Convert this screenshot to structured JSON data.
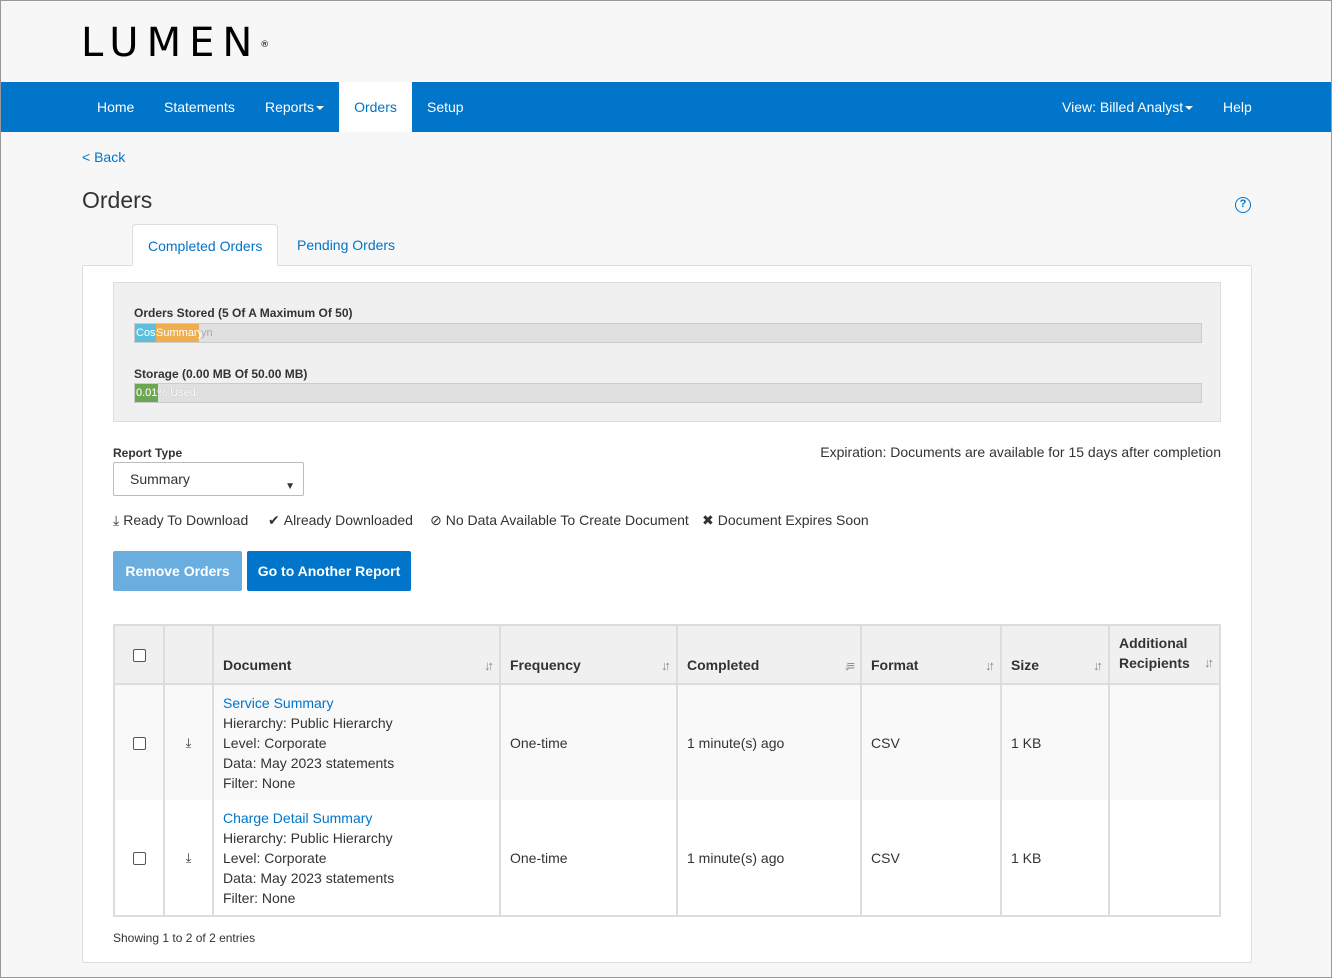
{
  "brand": {
    "logo_text": "LUMEN",
    "trademark": "®"
  },
  "nav": {
    "home": "Home",
    "statements": "Statements",
    "reports": "Reports",
    "orders": "Orders",
    "setup": "Setup",
    "view": "View: Billed Analyst",
    "help": "Help"
  },
  "back_label": "< Back",
  "page_title": "Orders",
  "help_icon_glyph": "?",
  "tabs": {
    "completed": "Completed Orders",
    "pending": "Pending Orders"
  },
  "usage": {
    "orders_label": "Orders Stored (5 Of A Maximum Of 50)",
    "orders_segments": [
      {
        "label": "Cos",
        "fraction": 0.02,
        "color": "#5bc0de"
      },
      {
        "label": "Summary",
        "fraction": 0.04,
        "color": "#f0ad4e"
      }
    ],
    "orders_overflow_text": "yn",
    "storage_label": "Storage (0.00 MB Of 50.00 MB)",
    "storage_fill_text": "0.01% Used",
    "storage_fraction": 0.022,
    "storage_color": "#6aa84f"
  },
  "report_type": {
    "label": "Report Type",
    "selected": "Summary"
  },
  "expiration": "Expiration: Documents are available for 15 days after completion",
  "legend": {
    "ready": "Ready To Download",
    "downloaded": "Already Downloaded",
    "no_data": "No Data Available To Create Document",
    "expires": "Document Expires Soon"
  },
  "buttons": {
    "remove": "Remove Orders",
    "goto": "Go to Another Report"
  },
  "table": {
    "headers": {
      "document": "Document",
      "frequency": "Frequency",
      "completed": "Completed",
      "format": "Format",
      "size": "Size",
      "additional_1": "Additional",
      "additional_2": "Recipients"
    },
    "rows": [
      {
        "title": "Service Summary",
        "hierarchy": "Hierarchy: Public Hierarchy",
        "level": "Level: Corporate",
        "data": "Data: May 2023 statements",
        "filter": "Filter: None",
        "frequency": "One-time",
        "completed": "1 minute(s) ago",
        "format": "CSV",
        "size": "1 KB",
        "recipients": ""
      },
      {
        "title": "Charge Detail Summary",
        "hierarchy": "Hierarchy: Public Hierarchy",
        "level": "Level: Corporate",
        "data": "Data: May 2023 statements",
        "filter": "Filter: None",
        "frequency": "One-time",
        "completed": "1 minute(s) ago",
        "format": "CSV",
        "size": "1 KB",
        "recipients": ""
      }
    ]
  },
  "footer_info": "Showing 1 to 2 of 2 entries",
  "colors": {
    "primary": "#0075c9",
    "button_disabled": "#6aaee0"
  }
}
